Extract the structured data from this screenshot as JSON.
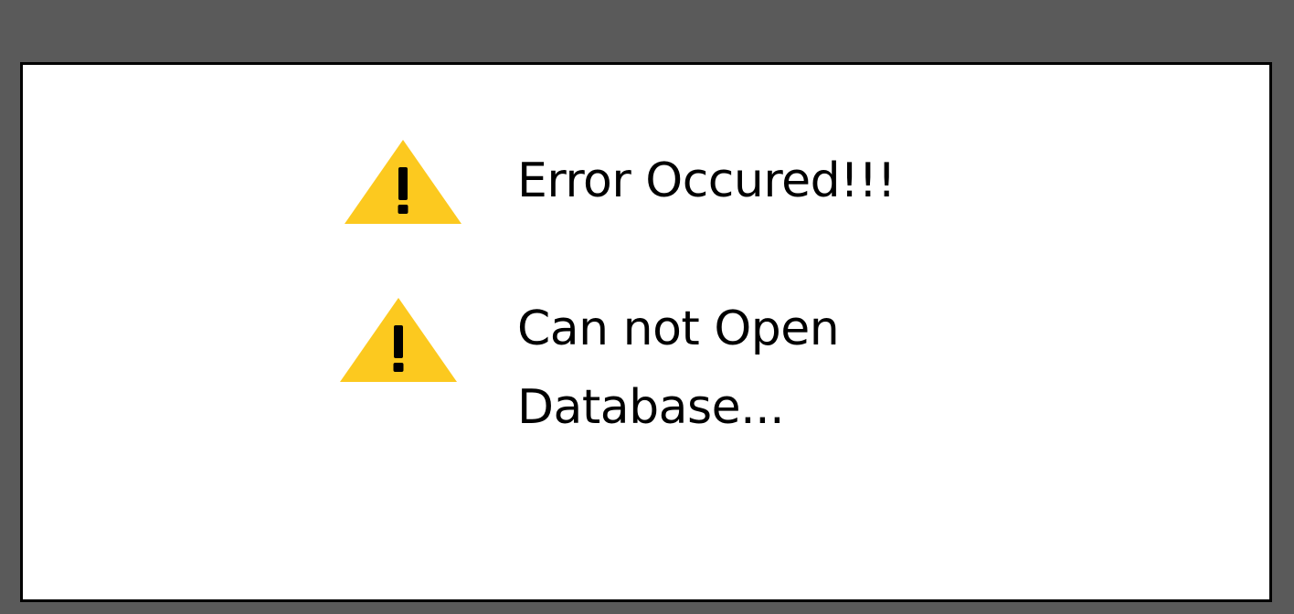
{
  "dialog": {
    "messages": [
      {
        "icon": "warning-icon",
        "lines": [
          "Error Occured!!!"
        ]
      },
      {
        "icon": "warning-icon",
        "lines": [
          "Can not Open",
          "Database..."
        ]
      }
    ]
  },
  "colors": {
    "background": "#5a5a5a",
    "dialog_background": "#ffffff",
    "dialog_border": "#000000",
    "warning": "#fcc91f",
    "text": "#000000"
  }
}
